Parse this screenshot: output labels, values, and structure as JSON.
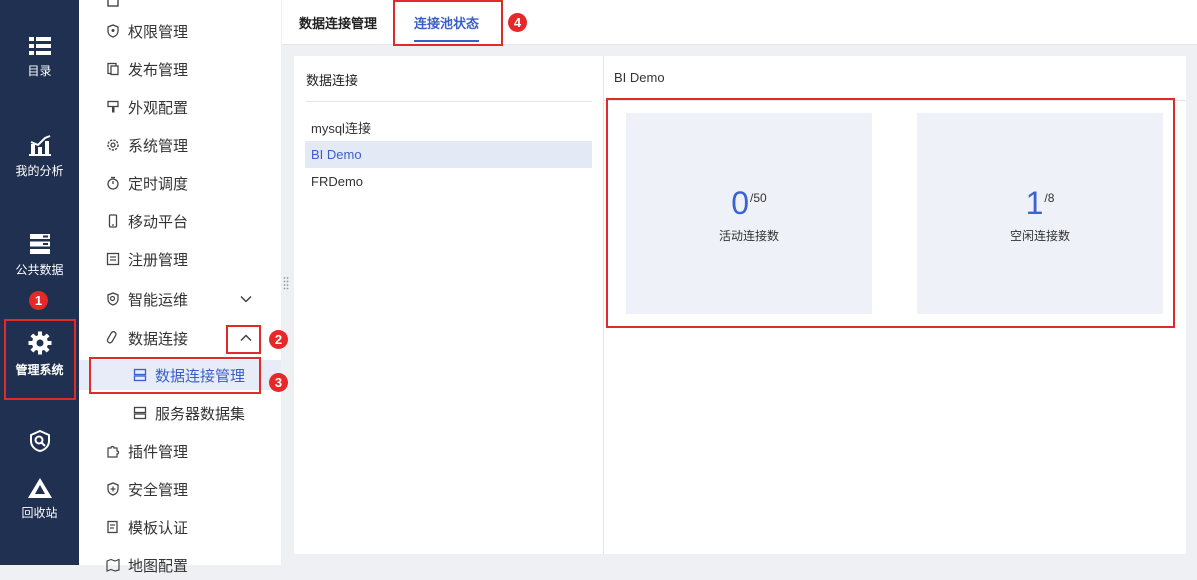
{
  "rail": {
    "items": [
      {
        "label": "目录",
        "icon": "list-icon"
      },
      {
        "label": "我的分析",
        "icon": "chart-icon"
      },
      {
        "label": "公共数据",
        "icon": "database-icon"
      },
      {
        "label": "管理系统",
        "icon": "gear-icon"
      },
      {
        "label": "",
        "icon": "shield-search-icon"
      },
      {
        "label": "回收站",
        "icon": "recycle-icon"
      }
    ]
  },
  "menu": {
    "items": [
      {
        "label": "权限管理",
        "icon": "permission-icon"
      },
      {
        "label": "发布管理",
        "icon": "publish-icon"
      },
      {
        "label": "外观配置",
        "icon": "brush-icon"
      },
      {
        "label": "系统管理",
        "icon": "settings-icon"
      },
      {
        "label": "定时调度",
        "icon": "timer-icon"
      },
      {
        "label": "移动平台",
        "icon": "mobile-icon"
      },
      {
        "label": "注册管理",
        "icon": "register-icon"
      },
      {
        "label": "智能运维",
        "icon": "ops-icon"
      },
      {
        "label": "数据连接",
        "icon": "link-icon"
      },
      {
        "label": "数据连接管理",
        "icon": "data-conn-icon"
      },
      {
        "label": "服务器数据集",
        "icon": "dataset-icon"
      },
      {
        "label": "插件管理",
        "icon": "plugin-icon"
      },
      {
        "label": "安全管理",
        "icon": "security-icon"
      },
      {
        "label": "模板认证",
        "icon": "template-icon"
      },
      {
        "label": "地图配置",
        "icon": "map-icon"
      }
    ]
  },
  "tabs": [
    {
      "label": "数据连接管理"
    },
    {
      "label": "连接池状态"
    }
  ],
  "connections": {
    "header": "数据连接",
    "items": [
      "mysql连接",
      "BI Demo",
      "FRDemo"
    ],
    "selected": "BI Demo"
  },
  "detail": {
    "title": "BI Demo",
    "stats": [
      {
        "value": "0",
        "max": "/50",
        "label": "活动连接数"
      },
      {
        "value": "1",
        "max": "/8",
        "label": "空闲连接数"
      }
    ]
  },
  "annotations": [
    "1",
    "2",
    "3",
    "4"
  ],
  "colors": {
    "rail": "#1f3050",
    "accent": "#3b5fc8",
    "annotation": "#e02b2b"
  }
}
